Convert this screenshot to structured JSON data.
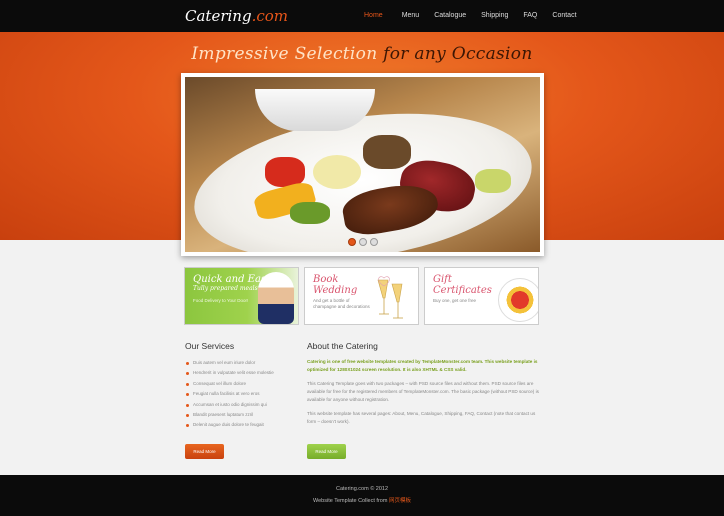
{
  "header": {
    "logo_main": "Catering",
    "logo_suffix": ".com",
    "nav": [
      {
        "label": "Home",
        "active": true
      },
      {
        "label": "Menu",
        "active": false
      },
      {
        "label": "Catalogue",
        "active": false
      },
      {
        "label": "Shipping",
        "active": false
      },
      {
        "label": "FAQ",
        "active": false
      },
      {
        "label": "Contact",
        "active": false
      }
    ]
  },
  "hero": {
    "tagline_light": "Impressive Selection",
    "tagline_dark": "for any Occasion",
    "slider_dots": 3,
    "active_dot": 0
  },
  "banners": [
    {
      "title_line1": "Quick and Easy",
      "title_line2": "Tully prepared meals",
      "sub": "Food Delivery to Your Door!"
    },
    {
      "title_line1": "Book",
      "title_line2": "Wedding",
      "sub": "And get a bottle of champagne and decorations"
    },
    {
      "title_line1": "Gift",
      "title_line2": "Certificates",
      "sub": "Buy one, get one free"
    }
  ],
  "services": {
    "title": "Our Services",
    "items": [
      "Duis autem vel eum iriure dolor",
      "Hendrerit in vulputate velit esse molestie",
      "Consequat vel illum dolore",
      "Feugiat nulla facilisis at vero eros",
      "Accumsan et iusto odio dignissim qui",
      "Blandit praesent luptatum zzril",
      "Delenit augue duis dolore te feugait"
    ],
    "button": "Read More"
  },
  "about": {
    "title": "About the Catering",
    "lead": "Catering is one of free website templates created by TemplateMonster.com team. This website template is optimized for 1280X1024 screen resolution. It is also XHTML & CSS valid.",
    "p2": "This Catering Template goes with two packages – with PSD source files and without them. PSD source files are available for free for the registered members of TemplateMonster.com. The basic package (without PSD source) is available for anyone without registration.",
    "p3": "This website template has several pages: About, Menu, Catalogue, Shipping, FAQ, Contact (note that contact us form – doesn't work).",
    "button": "Read More"
  },
  "footer": {
    "line1": "Catering.com © 2012",
    "line2_prefix": "Website Template Collect from",
    "line2_link": "网页模板"
  },
  "colors": {
    "accent": "#e4571a",
    "green": "#8cc63f",
    "dark": "#0b0b0b"
  }
}
